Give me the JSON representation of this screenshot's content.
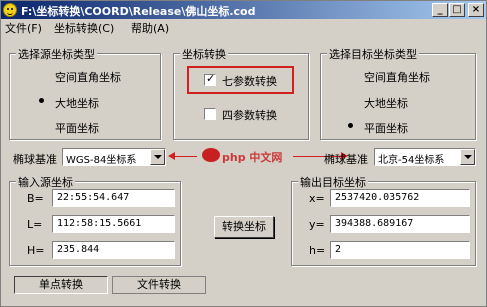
{
  "window": {
    "title": "F:\\坐标转换\\COORD\\Release\\佛山坐标.cod",
    "minimize_glyph": "_",
    "maximize_glyph": "□",
    "close_glyph": "×"
  },
  "menu": {
    "items": [
      "文件(F)",
      "坐标转换(C)",
      "帮助(A)"
    ]
  },
  "source_type": {
    "title": "选择源坐标类型",
    "options": [
      {
        "label": "空间直角坐标",
        "checked": false
      },
      {
        "label": "大地坐标",
        "checked": true
      },
      {
        "label": "平面坐标",
        "checked": false
      }
    ]
  },
  "transform": {
    "title": "坐标转换",
    "seven_param_label": "七参数转换",
    "seven_param_checked": true,
    "four_param_label": "四参数转换",
    "four_param_checked": false
  },
  "target_type": {
    "title": "选择目标坐标类型",
    "options": [
      {
        "label": "空间直角坐标",
        "checked": false
      },
      {
        "label": "大地坐标",
        "checked": false
      },
      {
        "label": "平面坐标",
        "checked": true
      }
    ]
  },
  "source_ellipsoid": {
    "label": "椭球基准",
    "value": "WGS-84坐标系"
  },
  "target_ellipsoid": {
    "label": "椭球基准",
    "value": "北京-54坐标系"
  },
  "watermark": {
    "text": "php 中文网"
  },
  "input": {
    "title": "输入源坐标",
    "fields": [
      {
        "label": "B=",
        "value": "22:55:54.647"
      },
      {
        "label": "L=",
        "value": "112:58:15.5661"
      },
      {
        "label": "H=",
        "value": "235.844"
      }
    ]
  },
  "convert_button": "转换坐标",
  "output": {
    "title": "输出目标坐标",
    "fields": [
      {
        "label": "x=",
        "value": "2537420.035762"
      },
      {
        "label": "y=",
        "value": "394388.689167"
      },
      {
        "label": "h=",
        "value": "2"
      }
    ]
  },
  "bottom_tabs": [
    "单点转换",
    "文件转换"
  ],
  "colors": {
    "highlight": "#d02020",
    "title_bar_start": "#0a246a",
    "window_bg": "#d4d0c8"
  }
}
